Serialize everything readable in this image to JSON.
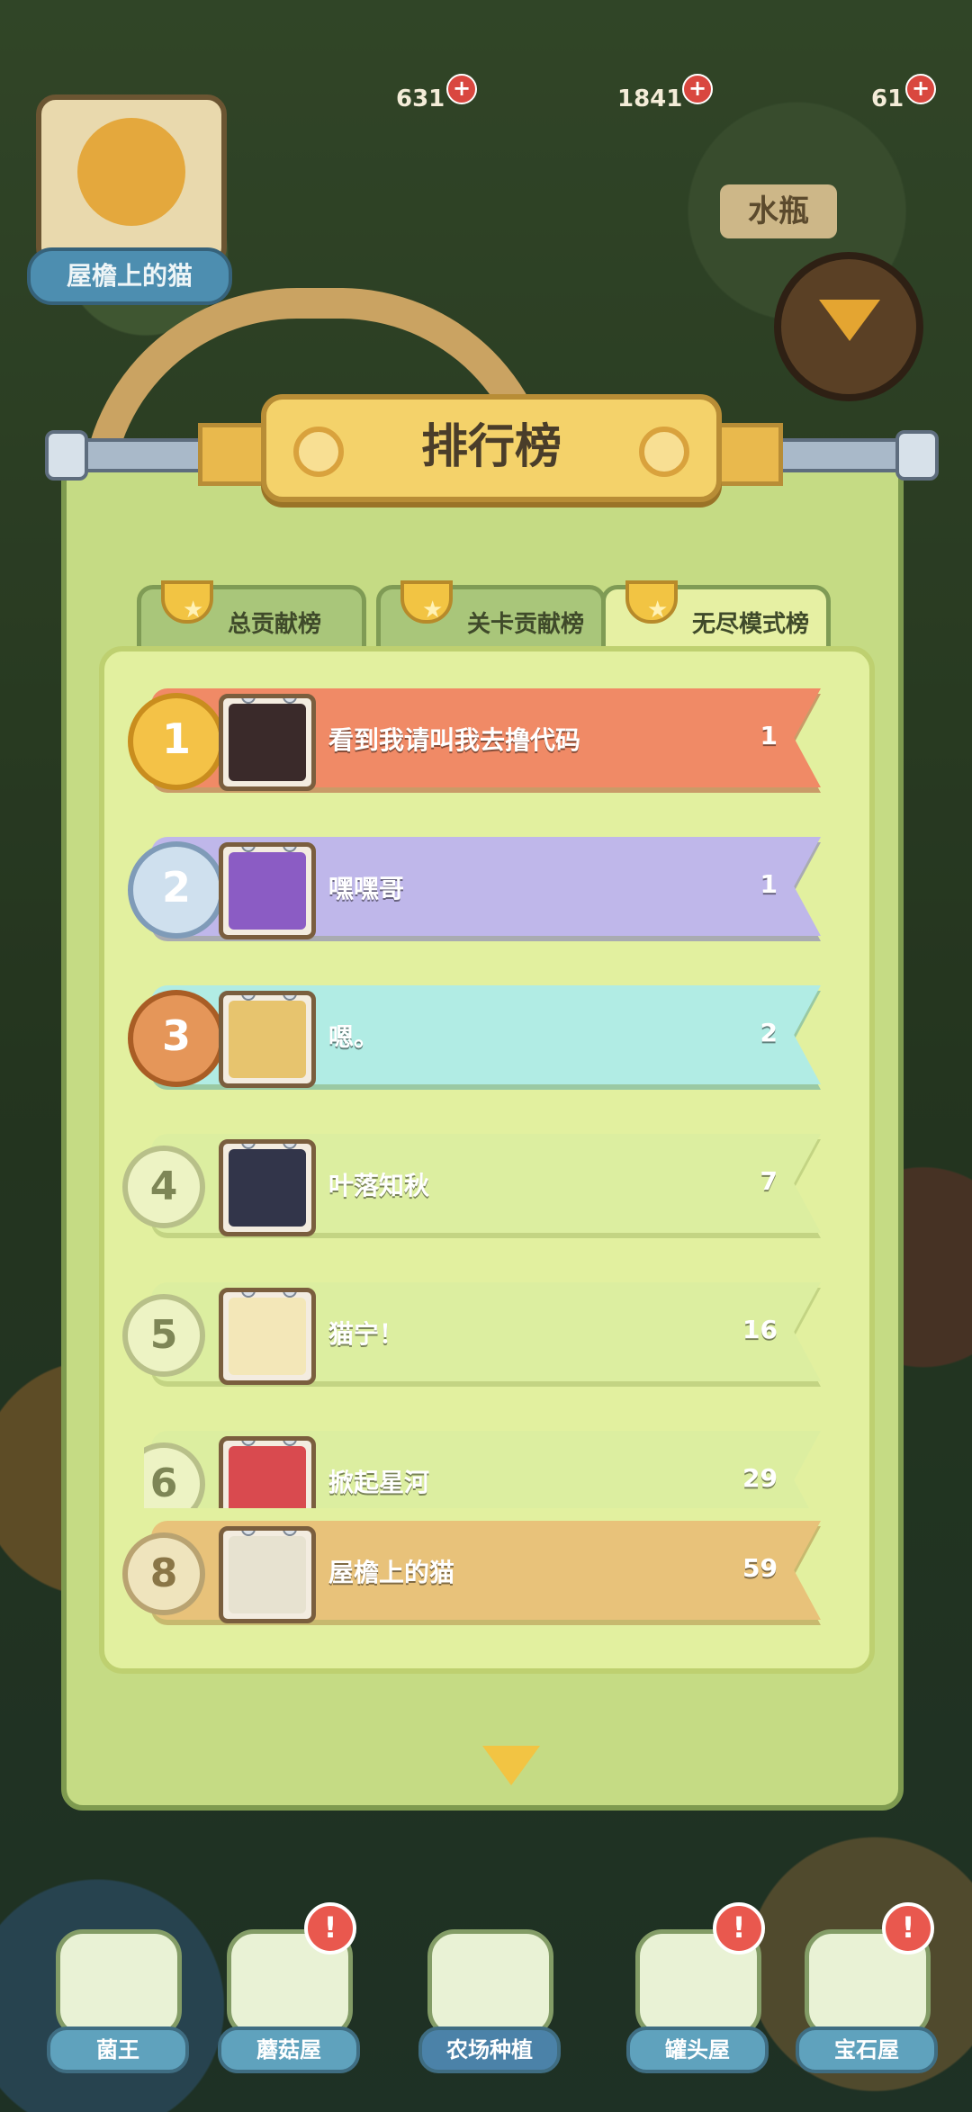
{
  "resources": [
    {
      "value": "631",
      "plus": "+"
    },
    {
      "value": "1841",
      "plus": "+"
    },
    {
      "value": "61",
      "plus": "+"
    }
  ],
  "player": {
    "name": "屋檐上的猫"
  },
  "background_sign": "水瓶",
  "leaderboard": {
    "title": "排行榜",
    "tabs": [
      {
        "label": "总贡献榜"
      },
      {
        "label": "关卡贡献榜"
      },
      {
        "label": "无尽模式榜"
      }
    ],
    "rows": [
      {
        "rank": "1",
        "name": "看到我请叫我去撸代码",
        "score": "1",
        "color": "#f08a66"
      },
      {
        "rank": "2",
        "name": "嘿嘿哥",
        "score": "1",
        "color": "#bfb7ea"
      },
      {
        "rank": "3",
        "name": "嗯。",
        "score": "2",
        "color": "#b1ece4"
      },
      {
        "rank": "4",
        "name": "叶落知秋",
        "score": "7",
        "color": "#dceea0"
      },
      {
        "rank": "5",
        "name": "猫宁！",
        "score": "16",
        "color": "#dceea0"
      },
      {
        "rank": "6",
        "name": "掀起星河",
        "score": "29",
        "color": "#dceea0"
      }
    ],
    "my_row": {
      "rank": "8",
      "name": "屋檐上的猫",
      "score": "59",
      "color": "#e8c27a"
    }
  },
  "nav": [
    {
      "label": "菌王",
      "alert": ""
    },
    {
      "label": "蘑菇屋",
      "alert": "!"
    },
    {
      "label": "农场种植",
      "alert": ""
    },
    {
      "label": "罐头屋",
      "alert": "!"
    },
    {
      "label": "宝石屋",
      "alert": "!"
    }
  ],
  "colors": {
    "gold": "#f2c443",
    "board": "#c5db84",
    "panel": "#e2f09f"
  }
}
